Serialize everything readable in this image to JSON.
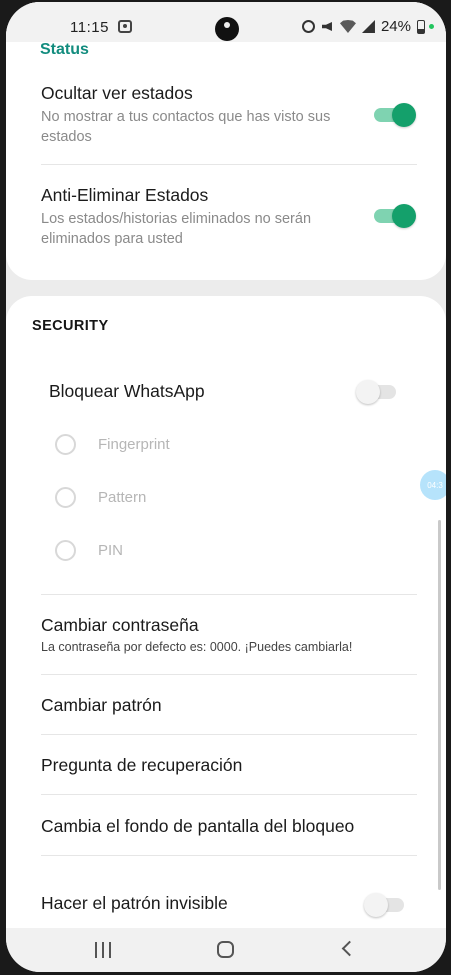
{
  "status_bar": {
    "time": "11:15",
    "battery": "24%",
    "icons": [
      "screen-record-icon",
      "alarm-icon",
      "mute-icon",
      "wifi-icon",
      "signal-icon",
      "battery-icon"
    ]
  },
  "status_section": {
    "header": "Status",
    "items": [
      {
        "title": "Ocultar ver estados",
        "subtitle": "No mostrar a tus contactos que has visto sus estados",
        "toggle_on": true
      },
      {
        "title": "Anti-Eliminar Estados",
        "subtitle": "Los estados/historias eliminados no serán eliminados para usted",
        "toggle_on": true
      }
    ]
  },
  "security_section": {
    "header": "SECURITY",
    "lock": {
      "title": "Bloquear WhatsApp",
      "toggle_on": false
    },
    "options": [
      "Fingerprint",
      "Pattern",
      "PIN"
    ],
    "items": [
      {
        "title": "Cambiar contraseña",
        "subtitle": "La contraseña por defecto es: 0000. ¡Puedes cambiarla!"
      },
      {
        "title": "Cambiar patrón"
      },
      {
        "title": "Pregunta de recuperación"
      },
      {
        "title": "Cambia el fondo de pantalla del bloqueo"
      },
      {
        "title": "Hacer el patrón invisible",
        "toggle_on": false
      }
    ]
  },
  "floating_bubble": {
    "label": "04:3"
  },
  "colors": {
    "accent": "#128C7E",
    "toggle_on": "#14A06B"
  }
}
